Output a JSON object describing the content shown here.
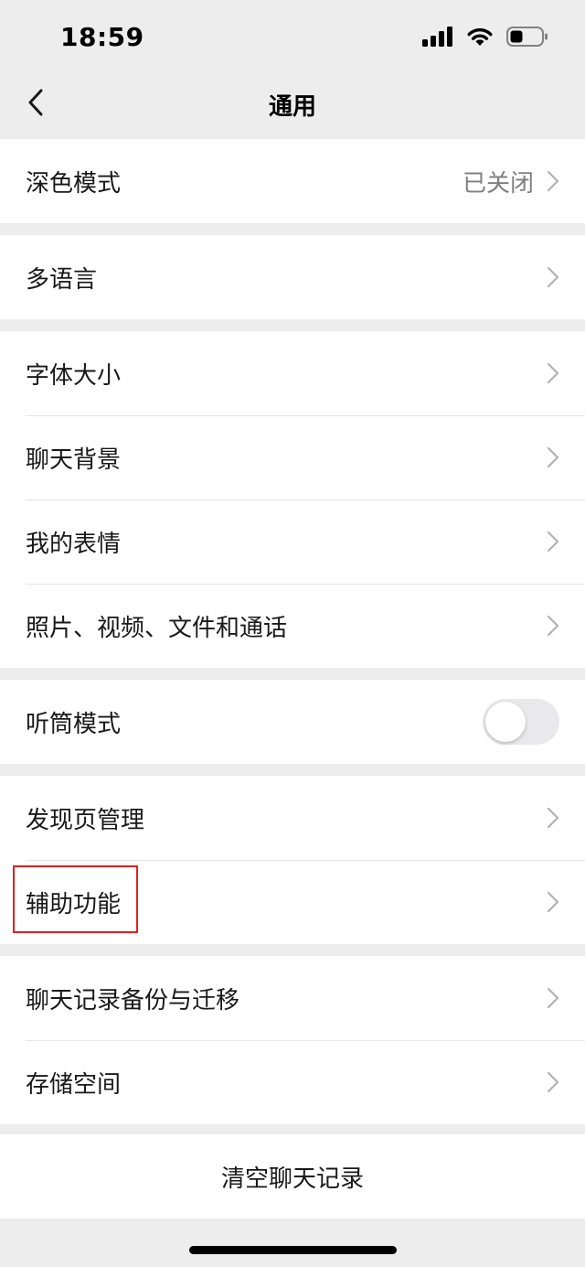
{
  "status_bar": {
    "time": "18:59",
    "icons": [
      "cellular-signal-icon",
      "wifi-icon",
      "battery-icon"
    ]
  },
  "nav": {
    "title": "通用",
    "back_icon": "chevron-left-icon"
  },
  "groups": [
    {
      "rows": [
        {
          "label": "深色模式",
          "value": "已关闭",
          "type": "link"
        }
      ]
    },
    {
      "rows": [
        {
          "label": "多语言",
          "type": "link"
        }
      ]
    },
    {
      "rows": [
        {
          "label": "字体大小",
          "type": "link"
        },
        {
          "label": "聊天背景",
          "type": "link"
        },
        {
          "label": "我的表情",
          "type": "link"
        },
        {
          "label": "照片、视频、文件和通话",
          "type": "link"
        }
      ]
    },
    {
      "rows": [
        {
          "label": "听筒模式",
          "type": "toggle",
          "on": false
        }
      ]
    },
    {
      "rows": [
        {
          "label": "发现页管理",
          "type": "link"
        },
        {
          "label": "辅助功能",
          "type": "link"
        }
      ]
    },
    {
      "rows": [
        {
          "label": "聊天记录备份与迁移",
          "type": "link"
        },
        {
          "label": "存储空间",
          "type": "link"
        }
      ]
    }
  ],
  "clear_history": {
    "label": "清空聊天记录"
  },
  "colors": {
    "background": "#ededed",
    "surface": "#ffffff",
    "text": "#191919",
    "secondary_text": "#7f7f7f",
    "chevron": "#b2b2b2",
    "highlight": "#e02020",
    "toggle_off": "#e9e9eb"
  }
}
